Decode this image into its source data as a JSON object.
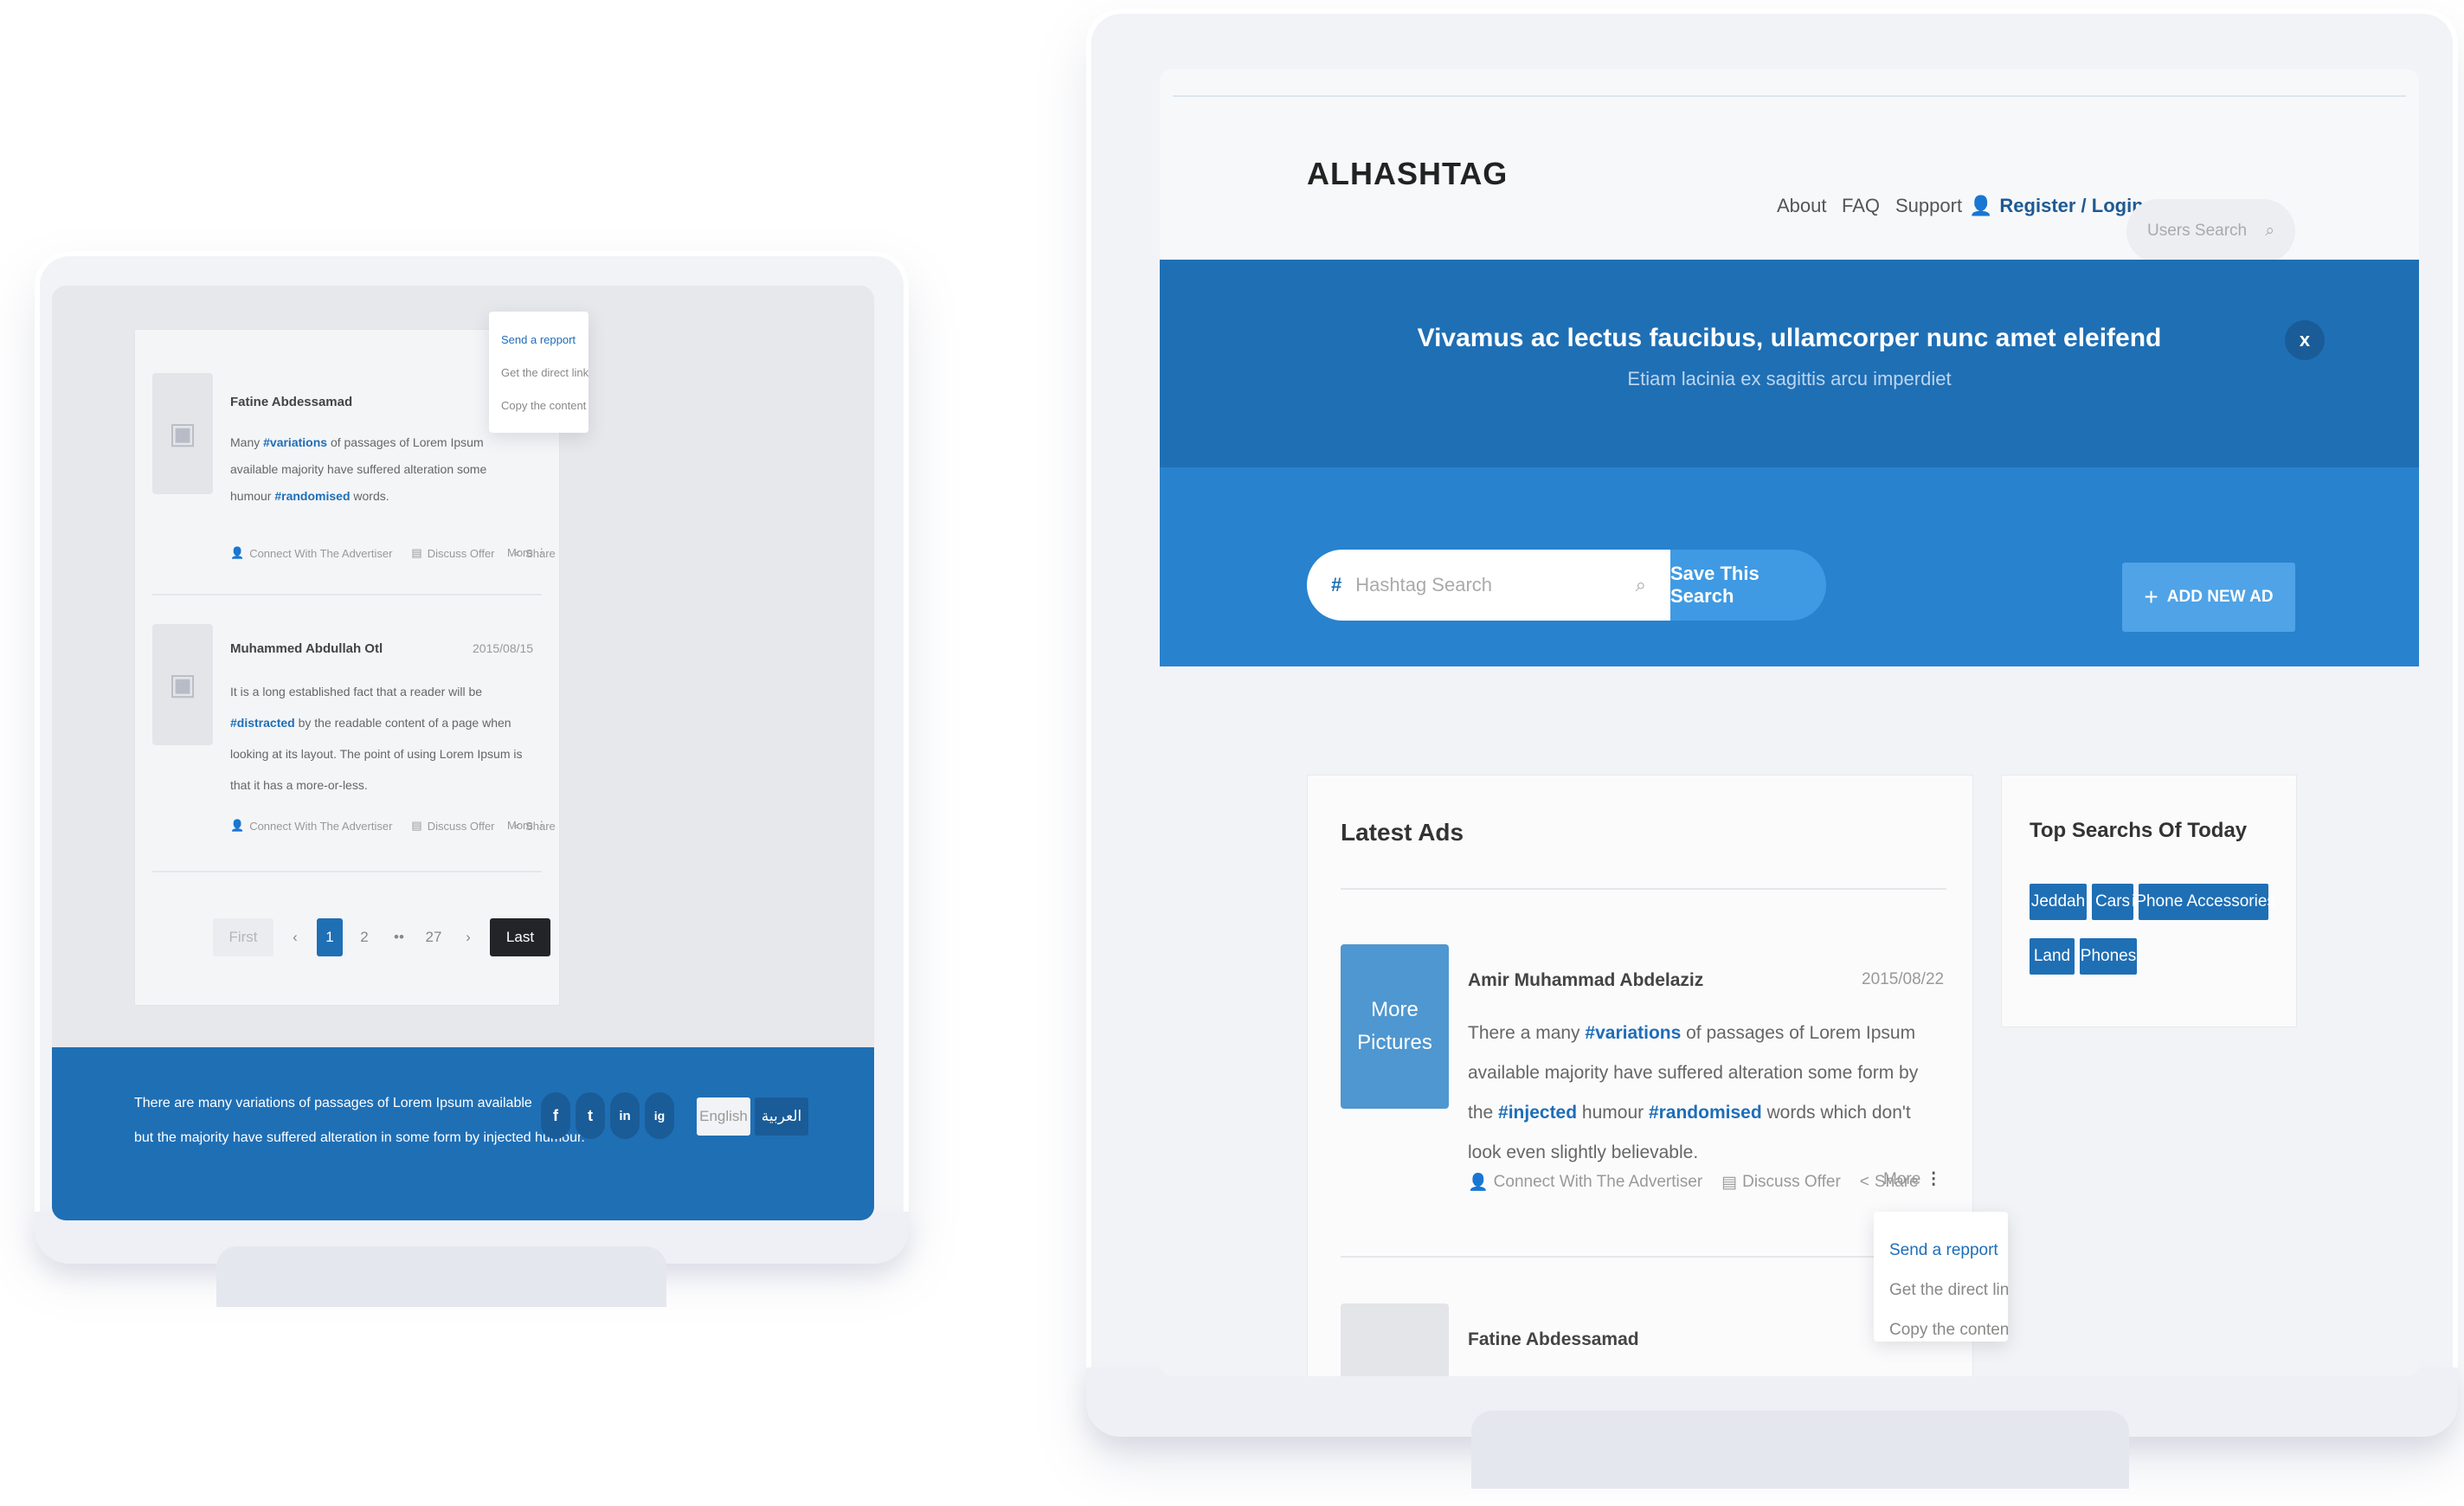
{
  "left_screen": {
    "ads": [
      {
        "advertiser": "Fatine Abdessamad",
        "date": "",
        "text_before": "Many ",
        "tag1": "#variations",
        "text_mid": " of passages of Lorem Ipsum available majority have suffered alteration some humour ",
        "tag2": "#randomised",
        "text_after": " words."
      },
      {
        "advertiser": "Muhammed Abdullah Otl",
        "date": "2015/08/15",
        "text_before": "It is a long established fact that a reader will be ",
        "tag1": "#distracted",
        "text_after": " by the readable content of a page when looking at its layout. The point of using Lorem Ipsum is that it has a more-or-less."
      }
    ],
    "actions": {
      "connect": "Connect With The Advertiser",
      "discuss": "Discuss Offer",
      "share": "Share",
      "more": "More"
    },
    "dropdown": {
      "send_report": "Send a repport",
      "get_link": "Get the direct link",
      "copy": "Copy the content"
    },
    "pagination": {
      "first": "First",
      "prev": "‹",
      "p1": "1",
      "p2": "2",
      "ellipsis": "••",
      "p27": "27",
      "next": "›",
      "last": "Last"
    },
    "footer": {
      "line1": "There are many variations of passages of Lorem Ipsum available",
      "line2": "but the majority have suffered alteration in some form by injected humour.",
      "social": [
        "f",
        "t",
        "in",
        "ig"
      ],
      "lang_english": "English",
      "lang_arabic": "العربية"
    }
  },
  "right_screen": {
    "header": {
      "logo": "ALHASHTAG",
      "nav_about": "About",
      "nav_faq": "FAQ",
      "nav_support": "Support",
      "nav_login": "Register / Login",
      "users_search_placeholder": "Users Search"
    },
    "announcement": {
      "title": "Vivamus ac lectus faucibus, ullamcorper nunc amet eleifend",
      "subtitle": "Etiam lacinia ex sagittis arcu imperdiet",
      "close": "x"
    },
    "search": {
      "hash_symbol": "#",
      "placeholder": "Hashtag Search",
      "save_button": "Save This Search",
      "add_ad_button": "ADD NEW AD",
      "add_symbol": "+"
    },
    "latest_ads": {
      "title": "Latest Ads",
      "first_ad": {
        "thumb_line1": "More",
        "thumb_line2": "Pictures",
        "advertiser": "Amir Muhammad Abdelaziz",
        "date": "2015/08/22",
        "text_before": "There a many ",
        "tag1": "#variations",
        "text_mid1": " of passages of Lorem Ipsum available majority have suffered alteration some form by the ",
        "tag2": "#injected",
        "text_mid2": " humour ",
        "tag3": "#randomised",
        "text_after": " words which don't look even slightly believable."
      },
      "second_ad": {
        "advertiser": "Fatine Abdessamad"
      },
      "actions": {
        "connect": "Connect With The Advertiser",
        "discuss": "Discuss Offer",
        "share": "Share",
        "more": "More"
      },
      "dropdown": {
        "send_report": "Send a repport",
        "get_link": "Get the direct link",
        "copy": "Copy the content"
      }
    },
    "top_searches": {
      "title": "Top Searchs Of Today",
      "tags": [
        "Jeddah",
        "Cars",
        "iPhone Accessories",
        "Land",
        "Phones"
      ]
    }
  },
  "colors": {
    "brand_blue": "#1f6fb5",
    "bright_blue": "#2882ce",
    "accent_blue": "#4fa3e6",
    "dark_button": "#232427"
  }
}
